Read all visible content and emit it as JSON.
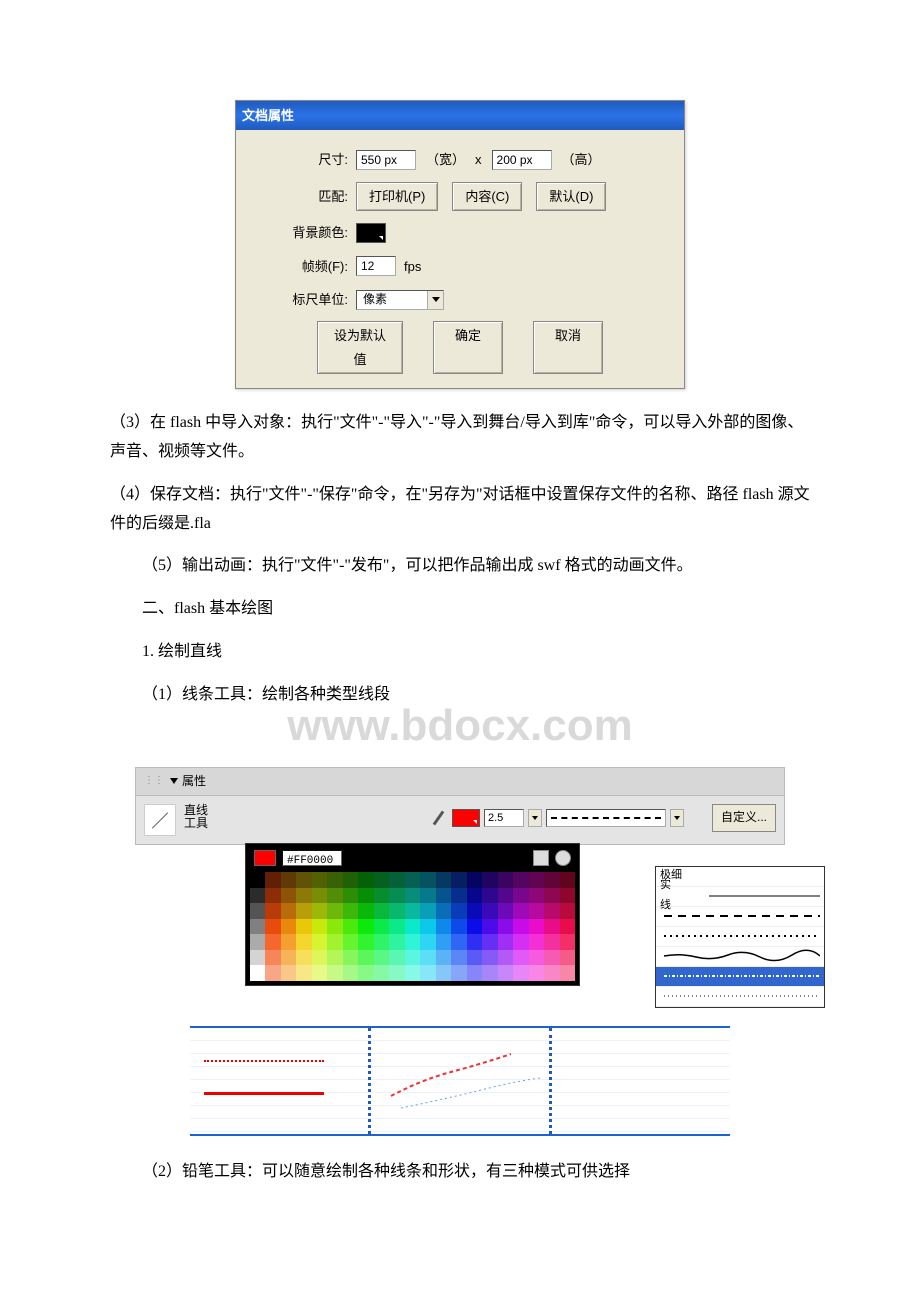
{
  "dialog": {
    "title": "文档属性",
    "labels": {
      "size": "尺寸:",
      "width_suffix": "（宽）",
      "x": "x",
      "height_suffix": "（高）",
      "match": "匹配:",
      "bg": "背景颜色:",
      "fps": "帧频(F):",
      "fps_unit": "fps",
      "ruler": "标尺单位:"
    },
    "width": "550 px",
    "height": "200 px",
    "printer_btn": "打印机(P)",
    "content_btn": "内容(C)",
    "default_btn": "默认(D)",
    "fps_value": "12",
    "ruler_value": "像素",
    "set_default": "设为默认值",
    "ok": "确定",
    "cancel": "取消"
  },
  "body": {
    "p3": "（3）在 flash 中导入对象：执行\"文件\"-\"导入\"-\"导入到舞台/导入到库\"命令，可以导入外部的图像、声音、视频等文件。",
    "p4": "（4）保存文档：执行\"文件\"-\"保存\"命令，在\"另存为\"对话框中设置保存文件的名称、路径 flash 源文件的后缀是.fla",
    "p5": "（5）输出动画：执行\"文件\"-\"发布\"，可以把作品输出成 swf 格式的动画文件。",
    "h2": "二、flash 基本绘图",
    "s1": "1. 绘制直线",
    "s1a": "（1）线条工具：绘制各种类型线段",
    "s2": "（2）铅笔工具：可以随意绘制各种线条和形状，有三种模式可供选择"
  },
  "watermark": "www.bdocx.com",
  "props_panel": {
    "title": "属性",
    "tool_name": "直线\n工具",
    "hex": "#FF0000",
    "stroke_weight": "2.5",
    "custom_btn": "自定义...",
    "styles": {
      "hairline": "极细",
      "solid": "实线"
    }
  }
}
